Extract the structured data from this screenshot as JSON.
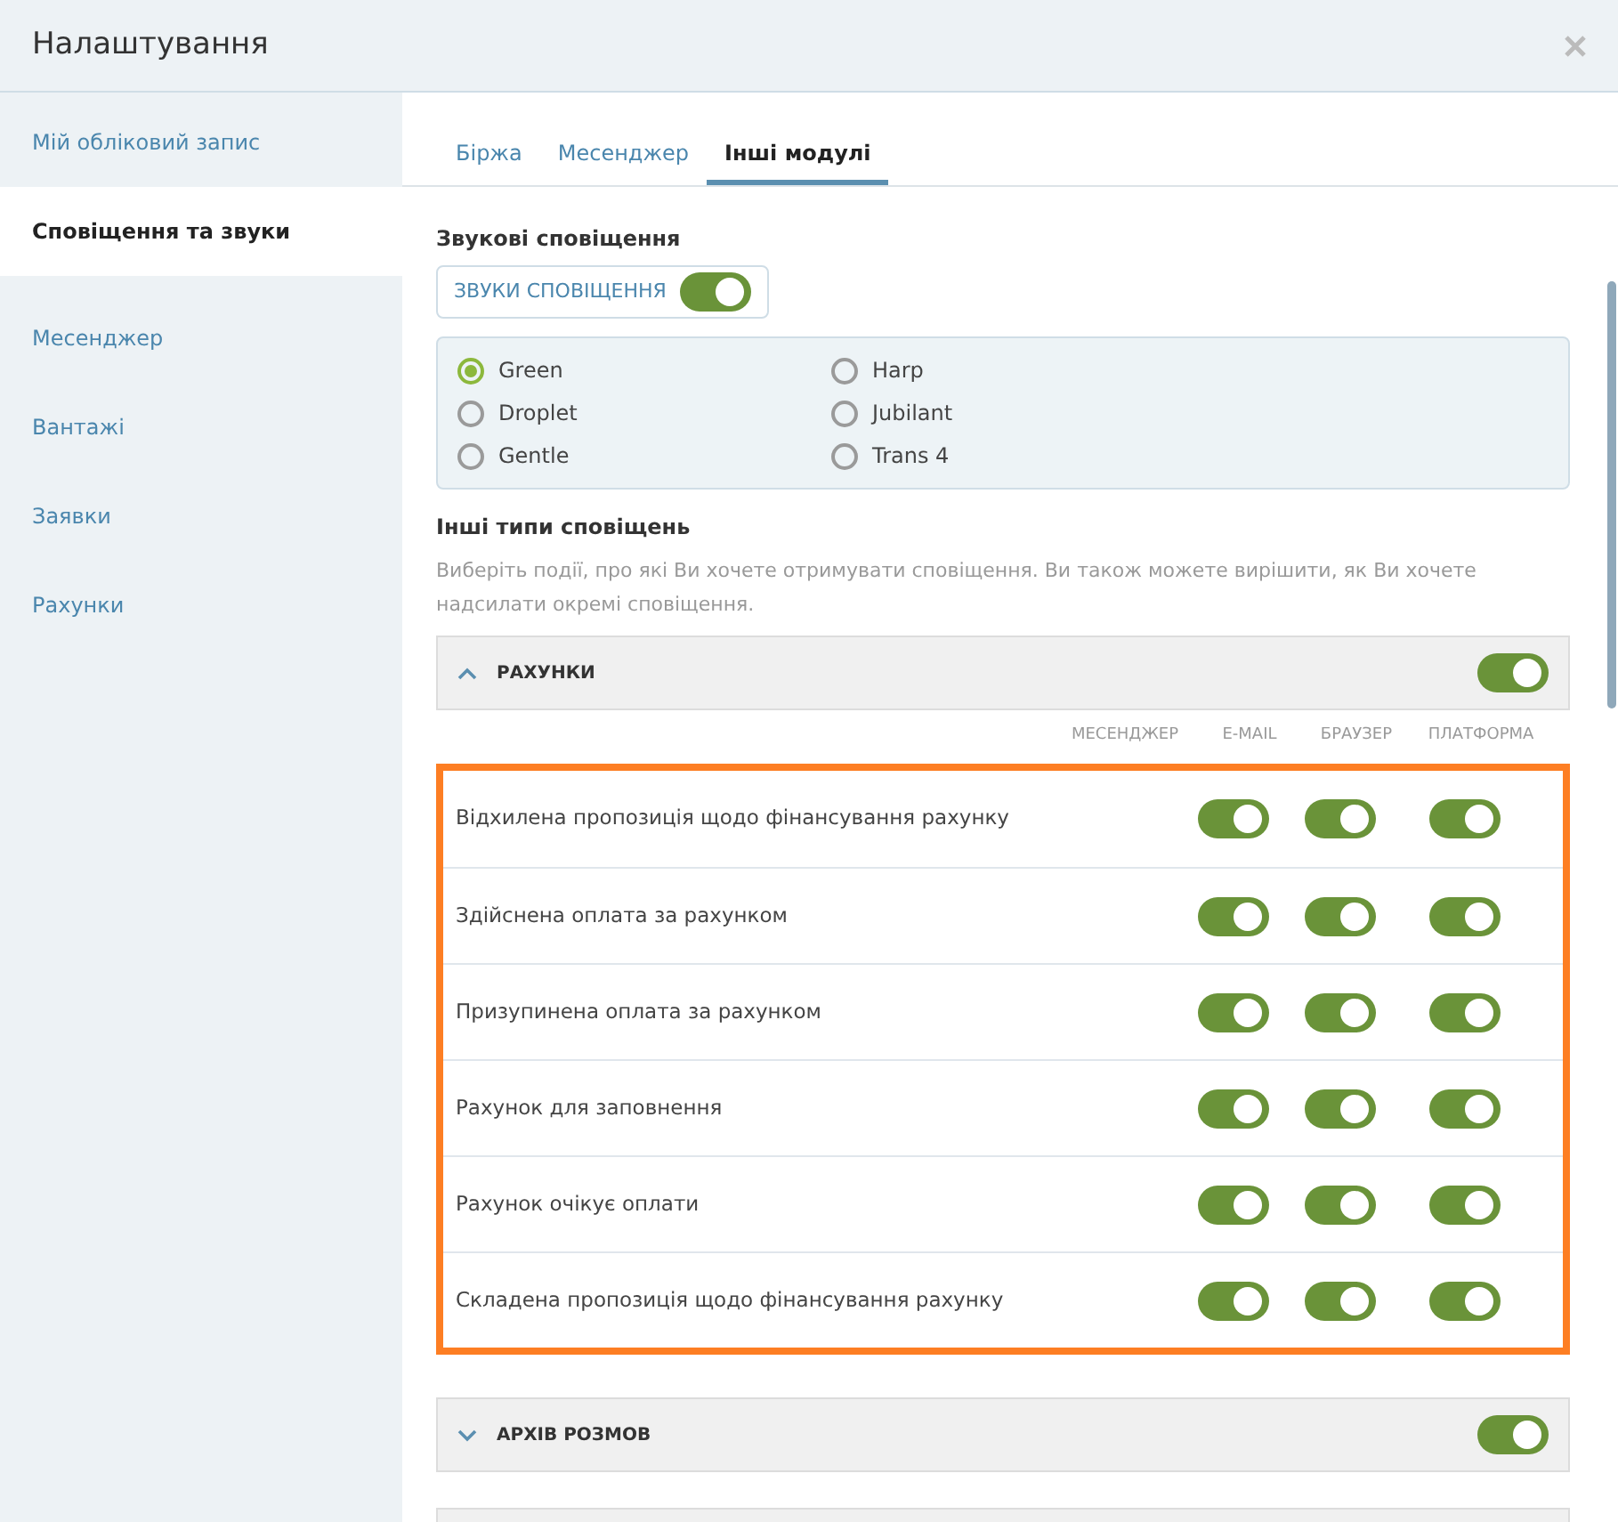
{
  "window": {
    "title": "Налаштування"
  },
  "sidebar": {
    "items": [
      {
        "label": "Мій обліковий запис",
        "selected": false
      },
      {
        "label": "Сповіщення та звуки",
        "selected": true
      },
      {
        "label": "Месенджер",
        "selected": false
      },
      {
        "label": "Вантажі",
        "selected": false
      },
      {
        "label": "Заявки",
        "selected": false
      },
      {
        "label": "Рахунки",
        "selected": false
      }
    ]
  },
  "tabs": [
    {
      "label": "Біржа",
      "selected": false
    },
    {
      "label": "Месенджер",
      "selected": false
    },
    {
      "label": "Інші модулі",
      "selected": true
    }
  ],
  "sound": {
    "heading": "Звукові сповіщення",
    "toggle_label": "ЗВУКИ СПОВІЩЕННЯ",
    "on": true,
    "options": [
      {
        "label": "Green",
        "selected": true
      },
      {
        "label": "Droplet",
        "selected": false
      },
      {
        "label": "Gentle",
        "selected": false
      },
      {
        "label": "Harp",
        "selected": false
      },
      {
        "label": "Jubilant",
        "selected": false
      },
      {
        "label": "Trans 4",
        "selected": false
      }
    ]
  },
  "other": {
    "heading": "Інші типи сповіщень",
    "description": "Виберіть події, про які Ви хочете отримувати сповіщення. Ви також можете вирішити, як Ви хочете надсилати окремі сповіщення."
  },
  "sections": [
    {
      "title": "РАХУНКИ",
      "expanded": true,
      "on": true,
      "columns": [
        "МЕСЕНДЖЕР",
        "E-MAIL",
        "БРАУЗЕР",
        "ПЛАТФОРМА"
      ],
      "rows": [
        {
          "label": "Відхилена пропозиція щодо фінансування рахунку",
          "toggles": [
            {
              "on": true
            },
            {
              "on": true
            },
            {
              "on": true
            }
          ]
        },
        {
          "label": "Здійснена оплата за рахунком",
          "toggles": [
            {
              "on": true
            },
            {
              "on": true
            },
            {
              "on": true
            }
          ]
        },
        {
          "label": "Призупинена оплата за рахунком",
          "toggles": [
            {
              "on": true
            },
            {
              "on": true
            },
            {
              "on": true
            }
          ]
        },
        {
          "label": "Рахунок для заповнення",
          "toggles": [
            {
              "on": true
            },
            {
              "on": true
            },
            {
              "on": true
            }
          ]
        },
        {
          "label": "Рахунок очікує оплати",
          "toggles": [
            {
              "on": true
            },
            {
              "on": true
            },
            {
              "on": true
            }
          ]
        },
        {
          "label": "Складена пропозиція щодо фінансування рахунку",
          "toggles": [
            {
              "on": true
            },
            {
              "on": true
            },
            {
              "on": true
            }
          ]
        }
      ]
    },
    {
      "title": "АРХІВ РОЗМОВ",
      "expanded": false,
      "on": true
    }
  ]
}
